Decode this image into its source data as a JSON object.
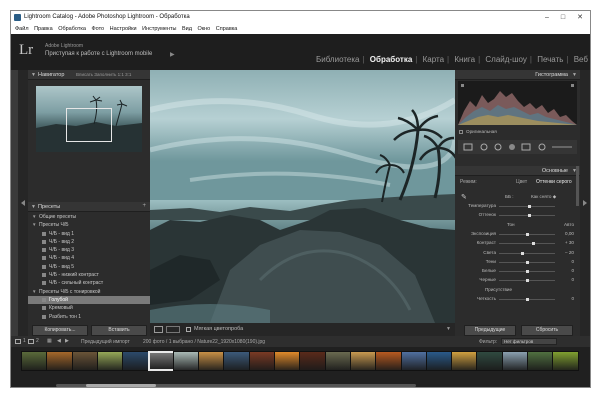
{
  "window": {
    "title": "Lightroom Catalog - Adobe Photoshop Lightroom - Обработка",
    "minimize_glyph": "–",
    "maximize_glyph": "□",
    "close_glyph": "✕"
  },
  "menu": [
    "Файл",
    "Правка",
    "Обработка",
    "Фото",
    "Настройки",
    "Инструменты",
    "Вид",
    "Окно",
    "Справка"
  ],
  "identity": {
    "logo": "Lr",
    "brand": "Adobe Lightroom",
    "tagline": "Приступая к работе с Lightroom mobile",
    "caret": "▶"
  },
  "modules": {
    "items": [
      "Библиотека",
      "Обработка",
      "Карта",
      "Книга",
      "Слайд-шоу",
      "Печать",
      "Веб"
    ],
    "active": "Обработка"
  },
  "navigator": {
    "title": "Навигатор",
    "options": "Вписать  Заполнить  1:1  3:1"
  },
  "presets": {
    "title": "Пресеты",
    "items": [
      {
        "label": "Общие пресеты",
        "level": 0,
        "type": "folder"
      },
      {
        "label": "Пресеты Ч/Б",
        "level": 0,
        "type": "folder"
      },
      {
        "label": "Ч/Б - вид 1",
        "level": 1,
        "type": "item"
      },
      {
        "label": "Ч/Б - вид 2",
        "level": 1,
        "type": "item"
      },
      {
        "label": "Ч/Б - вид 3",
        "level": 1,
        "type": "item"
      },
      {
        "label": "Ч/Б - вид 4",
        "level": 1,
        "type": "item"
      },
      {
        "label": "Ч/Б - вид 5",
        "level": 1,
        "type": "item"
      },
      {
        "label": "Ч/Б - низкий контраст",
        "level": 1,
        "type": "item"
      },
      {
        "label": "Ч/Б - сильный контраст",
        "level": 1,
        "type": "item"
      },
      {
        "label": "Пресеты Ч/Б с тонировкой",
        "level": 0,
        "type": "folder"
      },
      {
        "label": "Голубой",
        "level": 1,
        "type": "item",
        "selected": true
      },
      {
        "label": "Кремовый",
        "level": 1,
        "type": "item"
      },
      {
        "label": "Разбить тон 1",
        "level": 1,
        "type": "item"
      }
    ]
  },
  "left_buttons": {
    "copy": "Копировать...",
    "paste": "Вставить"
  },
  "toolbar": {
    "soft_proof": "Мягкая цветопроба"
  },
  "histogram": {
    "title": "Гистограмма",
    "original": "Оригинальная"
  },
  "basic": {
    "title": "Основные",
    "treatment_label": "Режим:",
    "tab_color": "Цвет",
    "tab_bw": "Оттенки серого",
    "wb_label": "ББ :",
    "wb_value": "Как снято ◆",
    "rows": [
      {
        "label": "Температура",
        "value": "",
        "pos": 0.55
      },
      {
        "label": "Оттенок",
        "value": "",
        "pos": 0.55
      },
      {
        "label": "Тон",
        "value": "Авто",
        "pos": null
      },
      {
        "label": "Экспозиция",
        "value": "0,00",
        "pos": 0.5
      },
      {
        "label": "Контраст",
        "value": "+ 30",
        "pos": 0.62
      },
      {
        "label": "Света",
        "value": "– 20",
        "pos": 0.42
      },
      {
        "label": "Тени",
        "value": "0",
        "pos": 0.5
      },
      {
        "label": "Белые",
        "value": "0",
        "pos": 0.5
      },
      {
        "label": "Черные",
        "value": "0",
        "pos": 0.5
      },
      {
        "label": "Присутствие",
        "value": "",
        "pos": null
      },
      {
        "label": "Четкость",
        "value": "0",
        "pos": 0.5
      }
    ]
  },
  "right_buttons": {
    "previous": "Предыдущие",
    "reset": "Сбросить"
  },
  "filmstrip": {
    "page1": "1",
    "page2": "2",
    "breadcrumb": "Предыдущий импорт",
    "count": "200 фото / 1 выбрано / Nature22_1920x1080(190).jpg",
    "filter_label": "Фильтр:",
    "filter_value": "Нет фильтров"
  },
  "thumbs": [
    "#5a6a3a",
    "#a5682a",
    "#6a5438",
    "#96a858",
    "#2c4a6b",
    "#777777",
    "#a9b9b5",
    "#c89046",
    "#3c5a7a",
    "#7a3a24",
    "#e08a2a",
    "#5a2a1a",
    "#6a6a50",
    "#c99a50",
    "#b85a20",
    "#5070a0",
    "#2a5a8a",
    "#d0a040",
    "#304a40",
    "#8aa0b0",
    "#507040",
    "#80a030"
  ],
  "colors": {
    "accent": "#ffffff",
    "panel": "#2c2c2c",
    "photo_sky": "#a9c7cb",
    "photo_water": "#4e7a80"
  }
}
